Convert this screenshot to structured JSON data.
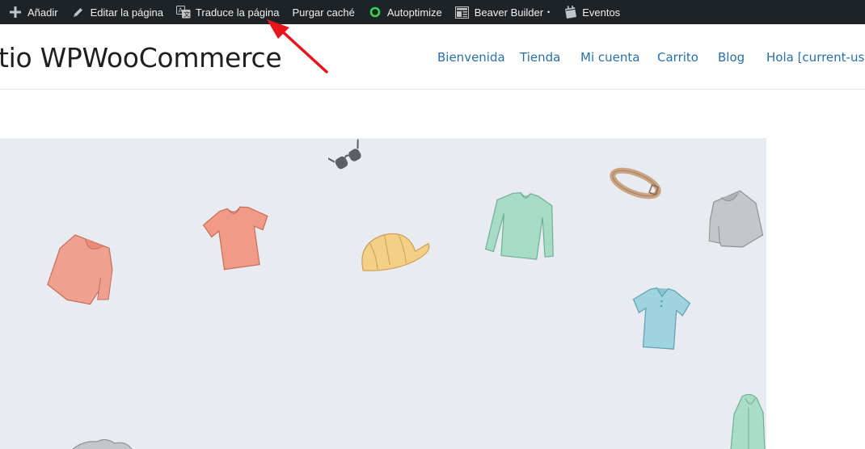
{
  "adminbar": {
    "add": "Añadir",
    "edit": "Editar la página",
    "translate": "Traduce la página",
    "purge": "Purgar caché",
    "autoptimize": "Autoptimize",
    "beaver": "Beaver Builder",
    "beaver_dot": "•",
    "events": "Eventos"
  },
  "header": {
    "site_title": "tio WPWooCommerce",
    "nav": [
      "Bienvenida",
      "Tienda",
      "Mi cuenta",
      "Carrito",
      "Blog",
      "Hola [current-user"
    ]
  },
  "colors": {
    "adminbar_bg": "#1d2327",
    "nav_link": "#2a6fa6",
    "hero_bg": "#e8ecf0",
    "annotation_arrow": "#e8151b",
    "autoptimize_ring": "#39d353"
  }
}
